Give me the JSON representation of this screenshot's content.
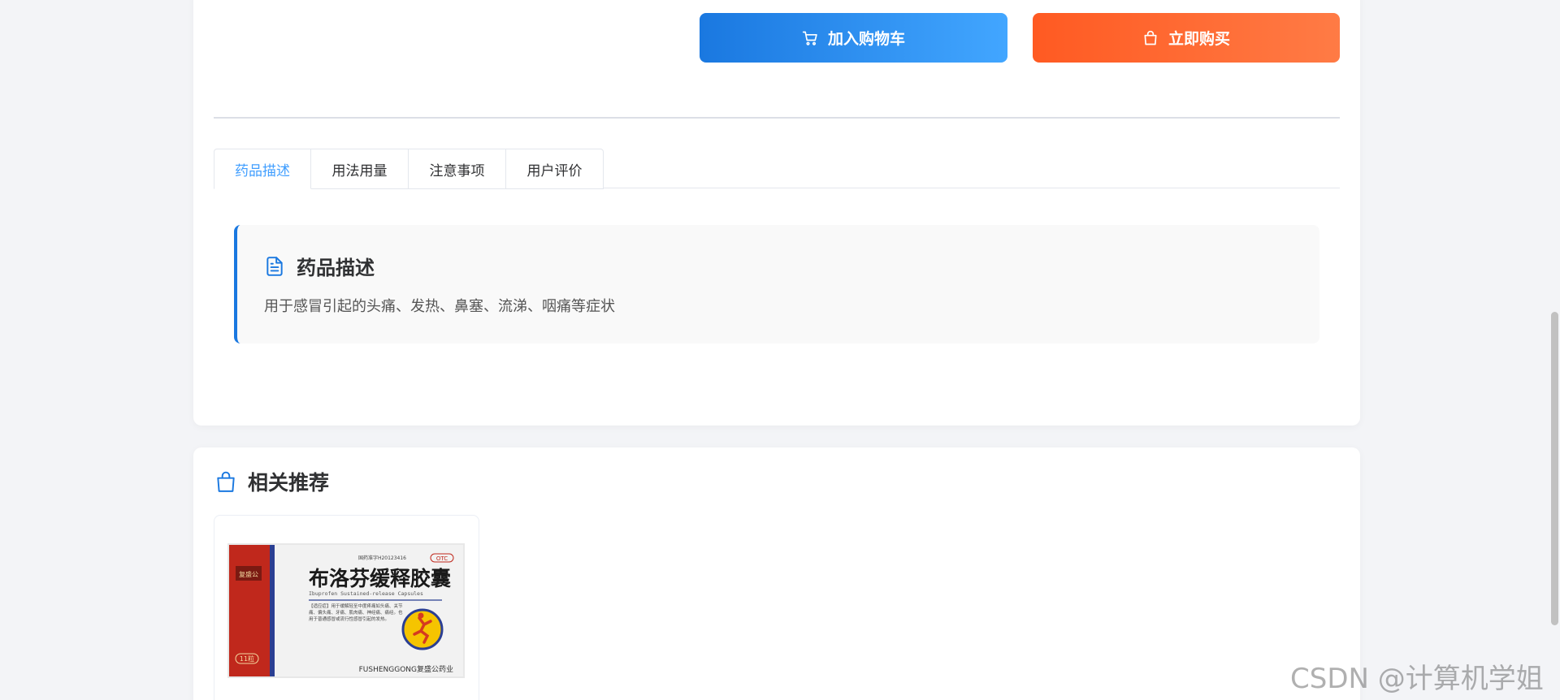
{
  "actions": {
    "add_to_cart_label": "加入购物车",
    "buy_now_label": "立即购买"
  },
  "tabs": [
    {
      "label": "药品描述",
      "active": true
    },
    {
      "label": "用法用量",
      "active": false
    },
    {
      "label": "注意事项",
      "active": false
    },
    {
      "label": "用户评价",
      "active": false
    }
  ],
  "description": {
    "heading": "药品描述",
    "text": "用于感冒引起的头痛、发热、鼻塞、流涕、咽痛等症状"
  },
  "recommendations": {
    "heading": "相关推荐",
    "items": [
      {
        "image": {
          "brand_logo_text": "复盛公",
          "product_name": "布洛芬缓释胶囊",
          "english_name": "Ibuprofen Sustained-release Capsules",
          "approval_number": "国药准字H20123416",
          "otc_badge": "OTC",
          "indication_text": "【适应症】用于缓解轻至中度疼痛如头痛、关节痛、偏头痛、牙痛、肌肉痛、神经痛、痛经。也用于普通感冒或流行性感冒引起的发热。",
          "count_badge": "11粒",
          "manufacturer": "FUSHENGGONG复盛公药业"
        }
      }
    ]
  },
  "watermark": "CSDN @计算机学姐",
  "colors": {
    "primary": "#1a78e0",
    "primary_light": "#42a6ff",
    "buy": "#ff5a22",
    "tab_active": "#409eff",
    "box_red": "#c0281c"
  },
  "icons": {
    "add_to_cart": "cart-icon",
    "buy_now": "shopping-bag-icon",
    "description": "document-icon",
    "recommendations": "shopping-bag-icon"
  }
}
